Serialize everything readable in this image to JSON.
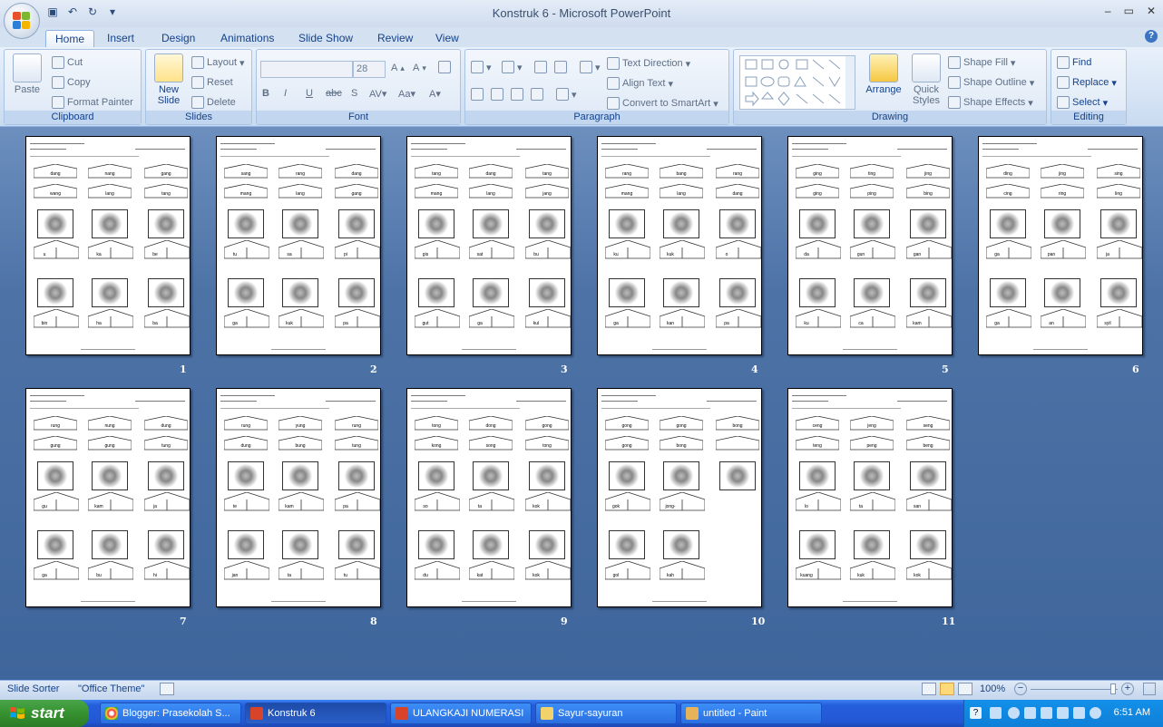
{
  "window": {
    "title": "Konstruk 6 - Microsoft PowerPoint",
    "controls": [
      "–",
      "▭",
      "✕"
    ]
  },
  "tabs": [
    "Home",
    "Insert",
    "Design",
    "Animations",
    "Slide Show",
    "Review",
    "View"
  ],
  "ribbon": {
    "clipboard": {
      "label": "Clipboard",
      "paste": "Paste",
      "cut": "Cut",
      "copy": "Copy",
      "format_painter": "Format Painter"
    },
    "slides": {
      "label": "Slides",
      "new_slide": "New Slide",
      "layout": "Layout",
      "reset": "Reset",
      "delete": "Delete"
    },
    "font": {
      "label": "Font",
      "size": "28",
      "font_name": ""
    },
    "paragraph": {
      "label": "Paragraph",
      "text_direction": "Text Direction",
      "align_text": "Align Text",
      "convert_smartart": "Convert to SmartArt"
    },
    "drawing": {
      "label": "Drawing",
      "arrange": "Arrange",
      "quick_styles": "Quick Styles",
      "shape_fill": "Shape Fill",
      "shape_outline": "Shape Outline",
      "shape_effects": "Shape Effects"
    },
    "editing": {
      "label": "Editing",
      "find": "Find",
      "replace": "Replace",
      "select": "Select"
    }
  },
  "slides": [
    {
      "num": "1",
      "top": [
        "dang",
        "nang",
        "gang",
        "wang",
        "lang",
        "tang"
      ],
      "bottom": [
        "u",
        "ka",
        "be",
        "bin",
        "ha",
        "ba"
      ]
    },
    {
      "num": "2",
      "top": [
        "sang",
        "rang",
        "dang",
        "mang",
        "lang",
        "gang"
      ],
      "bottom": [
        "tu",
        "sa",
        "pi",
        "ga",
        "kuk",
        "pa"
      ]
    },
    {
      "num": "3",
      "top": [
        "tang",
        "dang",
        "tang",
        "mang",
        "lang",
        "jang"
      ],
      "bottom": [
        "gis",
        "sat",
        "bu",
        "gut",
        "ga",
        "kul"
      ]
    },
    {
      "num": "4",
      "top": [
        "rang",
        "bang",
        "rang",
        "mang",
        "lang",
        "dang"
      ],
      "bottom": [
        "ku",
        "kuk",
        "o",
        "ga",
        "kan",
        "pa"
      ]
    },
    {
      "num": "5",
      "top": [
        "ging",
        "ting",
        "jing",
        "ging",
        "ping",
        "bing"
      ],
      "bottom": [
        "da",
        "gun",
        "gan",
        "ku",
        "ca",
        "kam"
      ]
    },
    {
      "num": "6",
      "top": [
        "ding",
        "jing",
        "sing",
        "cing",
        "ring",
        "ling"
      ],
      "bottom": [
        "ga",
        "pan",
        "ja",
        "ga",
        "an",
        "syil"
      ]
    },
    {
      "num": "7",
      "top": [
        "rung",
        "nung",
        "dung",
        "gung",
        "gung",
        "tung"
      ],
      "bottom": [
        "gu",
        "kam",
        "ja",
        "ga",
        "bu",
        "hi"
      ]
    },
    {
      "num": "8",
      "top": [
        "rung",
        "yung",
        "rung",
        "dung",
        "bung",
        "tung"
      ],
      "bottom": [
        "te",
        "kam",
        "pa",
        "jan",
        "ta",
        "tu"
      ]
    },
    {
      "num": "9",
      "top": [
        "tong",
        "dong",
        "gong",
        "kong",
        "song",
        "tong"
      ],
      "bottom": [
        "so",
        "ta",
        "kok",
        "du",
        "kat",
        "kok"
      ]
    },
    {
      "num": "10",
      "top": [
        "gong",
        "gong",
        "bong",
        "gong",
        "bong",
        ""
      ],
      "bottom": [
        "gok",
        "jong-",
        "",
        "gol",
        "kah",
        ""
      ]
    },
    {
      "num": "11",
      "top": [
        "ceng",
        "jeng",
        "seng",
        "teng",
        "peng",
        "beng"
      ],
      "bottom": [
        "lo",
        "ta",
        "san",
        "kuang",
        "kuk",
        "kok"
      ]
    }
  ],
  "statusbar": {
    "view": "Slide Sorter",
    "theme": "\"Office Theme\"",
    "zoom": "100%"
  },
  "taskbar": {
    "start": "start",
    "tasks": [
      "Blogger: Prasekolah S...",
      "Konstruk 6",
      "ULANGKAJI NUMERASI",
      "Sayur-sayuran",
      "untitled - Paint"
    ],
    "clock": "6:51 AM"
  },
  "colors": {
    "accent": "#15428b",
    "sorter_bg": "#4d72a6",
    "taskbar": "#245edb",
    "start": "#36912f"
  }
}
